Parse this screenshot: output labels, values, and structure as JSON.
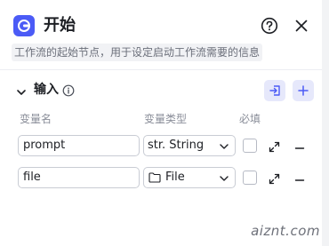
{
  "header": {
    "title": "开始",
    "description": "工作流的起始节点，用于设定启动工作流需要的信息",
    "icons": {
      "logo": "start-node-icon",
      "help": "help-circle-icon",
      "close": "close-icon"
    }
  },
  "inputs_section": {
    "title": "输入",
    "icons": {
      "collapse": "chevron-down-icon",
      "info": "info-icon",
      "import": "import-icon",
      "add": "plus-icon"
    },
    "columns": {
      "name": "变量名",
      "type": "变量类型",
      "required": "必填"
    },
    "rows": [
      {
        "name": "prompt",
        "type": "str. String",
        "type_icon": "",
        "required": false
      },
      {
        "name": "file",
        "type": "File",
        "type_icon": "folder-icon",
        "required": false
      }
    ]
  },
  "watermark": "aiznt.com",
  "colors": {
    "accent": "#4b5bf6",
    "accent_soft": "#e6e8fb"
  }
}
